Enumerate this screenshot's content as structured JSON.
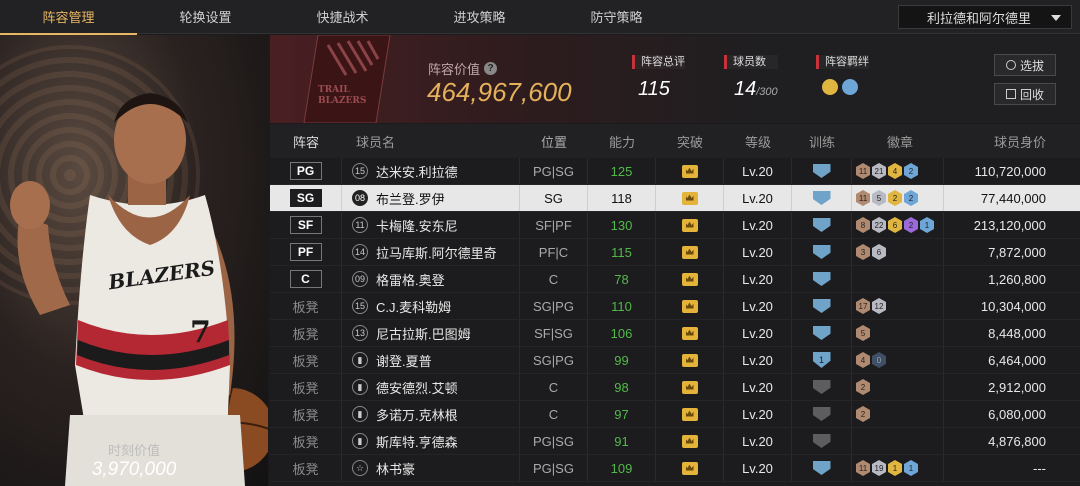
{
  "nav": {
    "tabs": [
      "阵容管理",
      "轮换设置",
      "快捷战术",
      "进攻策略",
      "防守策略"
    ],
    "active_tab": 0,
    "team_select": "利拉德和阿尔德里"
  },
  "portrait": {
    "label": "时刻价值",
    "value": "3,970,000",
    "jersey_text": "BLAZERS",
    "jersey_number": "7"
  },
  "header": {
    "logo_text": "TRAIL BLAZERS",
    "value_label": "阵容价值",
    "value": "464,967,600",
    "overall_label": "阵容总评",
    "overall": "115",
    "count_label": "球员数",
    "count": "14",
    "count_max": "/300",
    "bond_label": "阵容羁绊",
    "pick_button": "选拔",
    "recycle_button": "回收"
  },
  "table": {
    "headers": [
      "阵容",
      "球员名",
      "位置",
      "能力",
      "突破",
      "等级",
      "训练",
      "徽章",
      "球员身价"
    ],
    "rows": [
      {
        "slot": "PG",
        "starter": true,
        "no": "15",
        "name": "达米安.利拉德",
        "pos": "PG|SG",
        "ability": "125",
        "level": "Lv.20",
        "train": "crown-shield",
        "badges": [
          [
            "b-bronze",
            "11"
          ],
          [
            "b-silver",
            "21"
          ],
          [
            "b-gold",
            "4"
          ],
          [
            "b-blue",
            "2"
          ]
        ],
        "value": "110,720,000"
      },
      {
        "slot": "SG",
        "starter": true,
        "selected": true,
        "no": "08",
        "name": "布兰登.罗伊",
        "pos": "SG",
        "ability": "118",
        "level": "Lv.20",
        "train": "crown-shield",
        "badges": [
          [
            "b-bronze",
            "11"
          ],
          [
            "b-silver",
            "5"
          ],
          [
            "b-gold",
            "2"
          ],
          [
            "b-blue",
            "2"
          ]
        ],
        "value": "77,440,000"
      },
      {
        "slot": "SF",
        "starter": true,
        "no": "11",
        "name": "卡梅隆.安东尼",
        "pos": "SF|PF",
        "ability": "130",
        "level": "Lv.20",
        "train": "crown-shield",
        "badges": [
          [
            "b-bronze",
            "8"
          ],
          [
            "b-silver",
            "22"
          ],
          [
            "b-gold",
            "6"
          ],
          [
            "b-purple",
            "2"
          ],
          [
            "b-blue",
            "1"
          ]
        ],
        "value": "213,120,000"
      },
      {
        "slot": "PF",
        "starter": true,
        "no": "14",
        "name": "拉马库斯.阿尔德里奇",
        "pos": "PF|C",
        "ability": "115",
        "level": "Lv.20",
        "train": "crown-shield",
        "badges": [
          [
            "b-bronze",
            "3"
          ],
          [
            "b-silver",
            "6"
          ]
        ],
        "value": "7,872,000"
      },
      {
        "slot": "C",
        "starter": true,
        "no": "09",
        "name": "格雷格.奥登",
        "pos": "C",
        "ability": "78",
        "level": "Lv.20",
        "train": "crown-shield",
        "badges": [],
        "value": "1,260,800"
      },
      {
        "slot": "板凳",
        "starter": false,
        "no": "15",
        "name": "C.J.麦科勒姆",
        "pos": "SG|PG",
        "ability": "110",
        "level": "Lv.20",
        "train": "crown-shield",
        "badges": [
          [
            "b-bronze",
            "17"
          ],
          [
            "b-silver",
            "12"
          ]
        ],
        "value": "10,304,000"
      },
      {
        "slot": "板凳",
        "starter": false,
        "no": "13",
        "name": "尼古拉斯.巴图姆",
        "pos": "SF|SG",
        "ability": "106",
        "level": "Lv.20",
        "train": "crown-shield",
        "badges": [
          [
            "b-bronze",
            "5"
          ]
        ],
        "value": "8,448,000"
      },
      {
        "slot": "板凳",
        "starter": false,
        "no": "",
        "name": "谢登.夏普",
        "pos": "SG|PG",
        "ability": "99",
        "level": "Lv.20",
        "train": "num-shield",
        "train_num": "1",
        "badges": [
          [
            "b-bronze",
            "4"
          ],
          [
            "b-dark",
            "0"
          ]
        ],
        "value": "6,464,000"
      },
      {
        "slot": "板凳",
        "starter": false,
        "no": "",
        "name": "德安德烈.艾顿",
        "pos": "C",
        "ability": "98",
        "level": "Lv.20",
        "train": "grey-shield",
        "badges": [
          [
            "b-bronze",
            "2"
          ]
        ],
        "value": "2,912,000"
      },
      {
        "slot": "板凳",
        "starter": false,
        "no": "",
        "name": "多诺万.克林根",
        "pos": "C",
        "ability": "97",
        "level": "Lv.20",
        "train": "grey-shield",
        "badges": [
          [
            "b-bronze",
            "2"
          ]
        ],
        "value": "6,080,000"
      },
      {
        "slot": "板凳",
        "starter": false,
        "no": "",
        "name": "斯库特.亨德森",
        "pos": "PG|SG",
        "ability": "91",
        "level": "Lv.20",
        "train": "grey-shield",
        "badges": [],
        "value": "4,876,800"
      },
      {
        "slot": "板凳",
        "starter": false,
        "no": "",
        "star": true,
        "name": "林书豪",
        "pos": "PG|SG",
        "ability": "109",
        "level": "Lv.20",
        "train": "crown-shield",
        "badges": [
          [
            "b-bronze",
            "11"
          ],
          [
            "b-silver",
            "19"
          ],
          [
            "b-gold",
            "1"
          ],
          [
            "b-blue",
            "1"
          ]
        ],
        "value": "---"
      }
    ]
  },
  "colors": {
    "accent": "#e7b764",
    "value_gold": "#e5b15a",
    "ability_green": "#52b94a",
    "stat_red": "#c8323a"
  }
}
